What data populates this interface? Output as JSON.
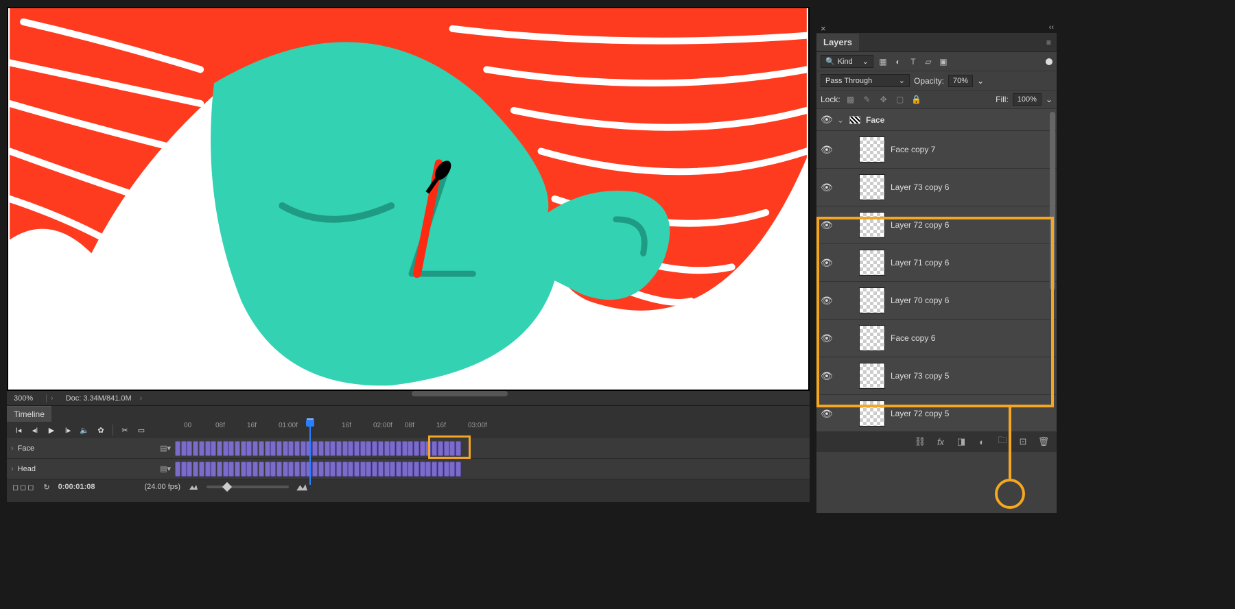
{
  "status": {
    "zoom": "300%",
    "doc": "Doc: 3.34M/841.0M"
  },
  "timeline": {
    "tab": "Timeline",
    "timecode": "0:00:01:08",
    "fps": "(24.00 fps)",
    "ruler": [
      "00",
      "08f",
      "16f",
      "01:00f",
      "16f",
      "02:00f",
      "08f",
      "16f",
      "03:00f"
    ],
    "tracks": [
      {
        "name": "Face"
      },
      {
        "name": "Head"
      }
    ],
    "frame_count": 48
  },
  "layers": {
    "title": "Layers",
    "filter_kind": "Kind",
    "blend_mode": "Pass Through",
    "opacity_label": "Opacity:",
    "opacity_value": "70%",
    "lock_label": "Lock:",
    "fill_label": "Fill:",
    "fill_value": "100%",
    "group_name": "Face",
    "items": [
      {
        "name": "Face copy 7"
      },
      {
        "name": "Layer 73 copy 6"
      },
      {
        "name": "Layer 72 copy 6"
      },
      {
        "name": "Layer 71 copy 6"
      },
      {
        "name": "Layer 70 copy 6"
      },
      {
        "name": "Face copy 6"
      },
      {
        "name": "Layer 73 copy 5"
      },
      {
        "name": "Layer 72 copy 5"
      }
    ]
  }
}
